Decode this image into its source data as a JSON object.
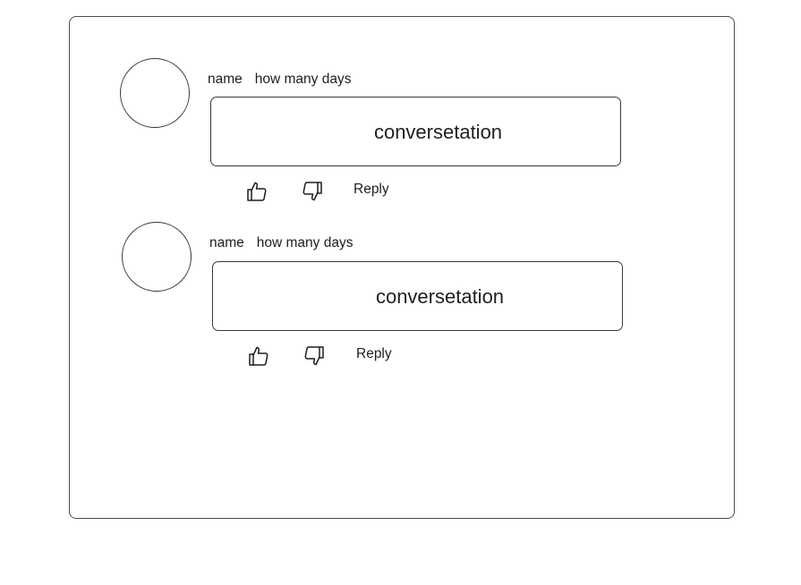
{
  "comments": [
    {
      "name": "name",
      "days": "how many days",
      "text": "conversetation",
      "like_icon": "thumbs-up-icon",
      "dislike_icon": "thumbs-down-icon",
      "reply_label": "Reply"
    },
    {
      "name": "name",
      "days": "how many days",
      "text": "conversetation",
      "like_icon": "thumbs-up-icon",
      "dislike_icon": "thumbs-down-icon",
      "reply_label": "Reply"
    }
  ]
}
